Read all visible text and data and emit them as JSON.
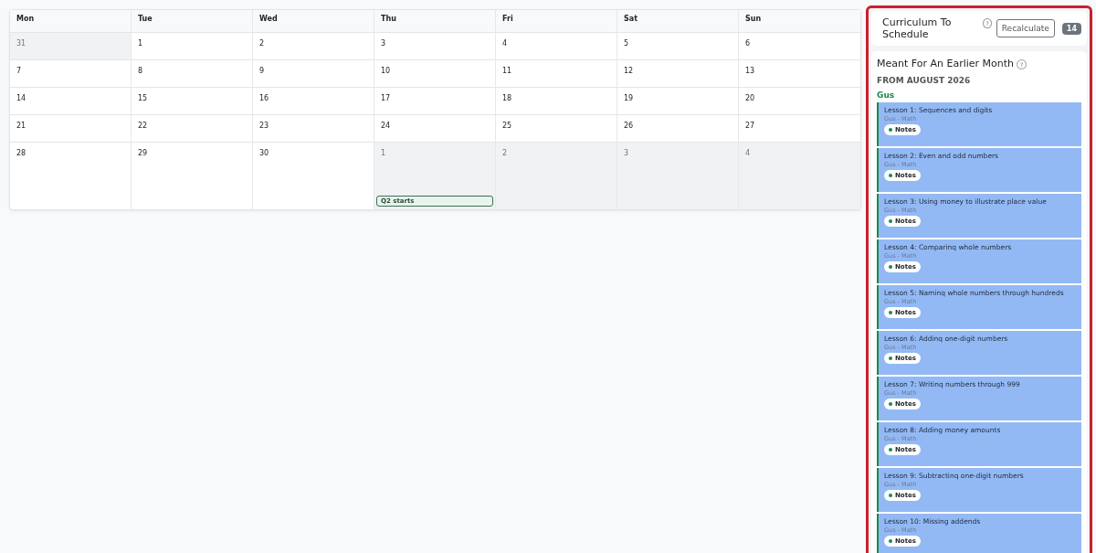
{
  "calendar": {
    "weekdays": [
      "Mon",
      "Tue",
      "Wed",
      "Thu",
      "Fri",
      "Sat",
      "Sun"
    ],
    "weeks": [
      [
        {
          "day": "31",
          "muted": true
        },
        {
          "day": "1",
          "muted": false
        },
        {
          "day": "2",
          "muted": false
        },
        {
          "day": "3",
          "muted": false
        },
        {
          "day": "4",
          "muted": false
        },
        {
          "day": "5",
          "muted": false
        },
        {
          "day": "6",
          "muted": false
        }
      ],
      [
        {
          "day": "7",
          "muted": false
        },
        {
          "day": "8",
          "muted": false
        },
        {
          "day": "9",
          "muted": false
        },
        {
          "day": "10",
          "muted": false
        },
        {
          "day": "11",
          "muted": false
        },
        {
          "day": "12",
          "muted": false
        },
        {
          "day": "13",
          "muted": false
        }
      ],
      [
        {
          "day": "14",
          "muted": false
        },
        {
          "day": "15",
          "muted": false
        },
        {
          "day": "16",
          "muted": false
        },
        {
          "day": "17",
          "muted": false
        },
        {
          "day": "18",
          "muted": false
        },
        {
          "day": "19",
          "muted": false
        },
        {
          "day": "20",
          "muted": false
        }
      ],
      [
        {
          "day": "21",
          "muted": false
        },
        {
          "day": "22",
          "muted": false
        },
        {
          "day": "23",
          "muted": false
        },
        {
          "day": "24",
          "muted": false
        },
        {
          "day": "25",
          "muted": false
        },
        {
          "day": "26",
          "muted": false
        },
        {
          "day": "27",
          "muted": false
        }
      ],
      [
        {
          "day": "28",
          "muted": false
        },
        {
          "day": "29",
          "muted": false
        },
        {
          "day": "30",
          "muted": false
        },
        {
          "day": "1",
          "muted": true,
          "events": [
            "Q2 starts"
          ]
        },
        {
          "day": "2",
          "muted": true
        },
        {
          "day": "3",
          "muted": true
        },
        {
          "day": "4",
          "muted": true
        }
      ]
    ]
  },
  "sidebar": {
    "title": "Curriculum To Schedule",
    "help": "?",
    "button": "Recalculate",
    "count": "14",
    "section": {
      "title": "Meant For An Earlier Month",
      "help": "?",
      "subtitle": "FROM AUGUST 2026",
      "student": "Gus",
      "lessons": [
        {
          "title": "Lesson 1: Sequences and digits",
          "meta": "Gus - Math",
          "tag": "Notes"
        },
        {
          "title": "Lesson 2: Even and odd numbers",
          "meta": "Gus - Math",
          "tag": "Notes"
        },
        {
          "title": "Lesson 3: Using money to illustrate place value",
          "meta": "Gus - Math",
          "tag": "Notes"
        },
        {
          "title": "Lesson 4: Comparinq whole numbers",
          "meta": "Gus - Math",
          "tag": "Notes"
        },
        {
          "title": "Lesson 5: Naminq whole numbers through hundreds",
          "meta": "Gus - Math",
          "tag": "Notes"
        },
        {
          "title": "Lesson 6: Addinq one-digit numbers",
          "meta": "Gus - Math",
          "tag": "Notes"
        },
        {
          "title": "Lesson 7: Writinq numbers through 999",
          "meta": "Gus - Math",
          "tag": "Notes"
        },
        {
          "title": "Lesson 8: Adding money amounts",
          "meta": "Gus - Math",
          "tag": "Notes"
        },
        {
          "title": "Lesson 9: Subtractinq one-digit numbers",
          "meta": "Gus - Math",
          "tag": "Notes"
        },
        {
          "title": "Lesson 10: Missing addends",
          "meta": "Gus - Math",
          "tag": "Notes"
        }
      ]
    }
  }
}
